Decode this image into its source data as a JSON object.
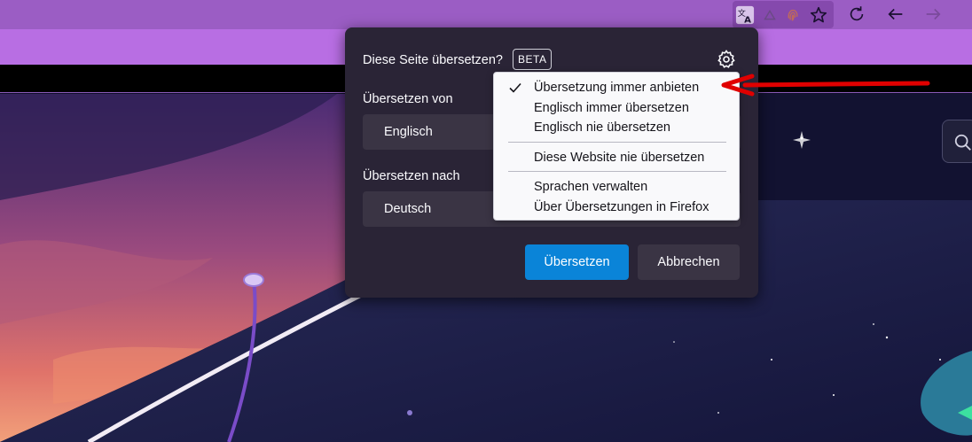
{
  "browser": {
    "toolbar_icons": [
      "translate-icon",
      "warning-triangle-icon",
      "fingerprint-icon",
      "bookmark-star-icon",
      "reload-icon",
      "back-arrow-icon",
      "forward-arrow-icon"
    ]
  },
  "panel": {
    "title": "Diese Seite übersetzen?",
    "badge": "BETA",
    "from_label": "Übersetzen von",
    "from_value": "Englisch",
    "to_label": "Übersetzen nach",
    "to_value": "Deutsch",
    "translate_button": "Übersetzen",
    "cancel_button": "Abbrechen"
  },
  "menu": {
    "items": [
      {
        "label": "Übersetzung immer anbieten",
        "checked": true
      },
      {
        "label": "Englisch immer übersetzen",
        "checked": false
      },
      {
        "label": "Englisch nie übersetzen",
        "checked": false
      },
      {
        "label": "Diese Website nie übersetzen",
        "checked": false
      },
      {
        "label": "Sprachen verwalten",
        "checked": false
      },
      {
        "label": "Über Übersetzungen in Firefox",
        "checked": false
      }
    ]
  },
  "colors": {
    "toolbar": "#9b5dc4",
    "tabstrip": "#b86ee3",
    "panel_bg": "#2a2436",
    "primary_button": "#0a84d8",
    "annotation_arrow": "#e00000"
  }
}
